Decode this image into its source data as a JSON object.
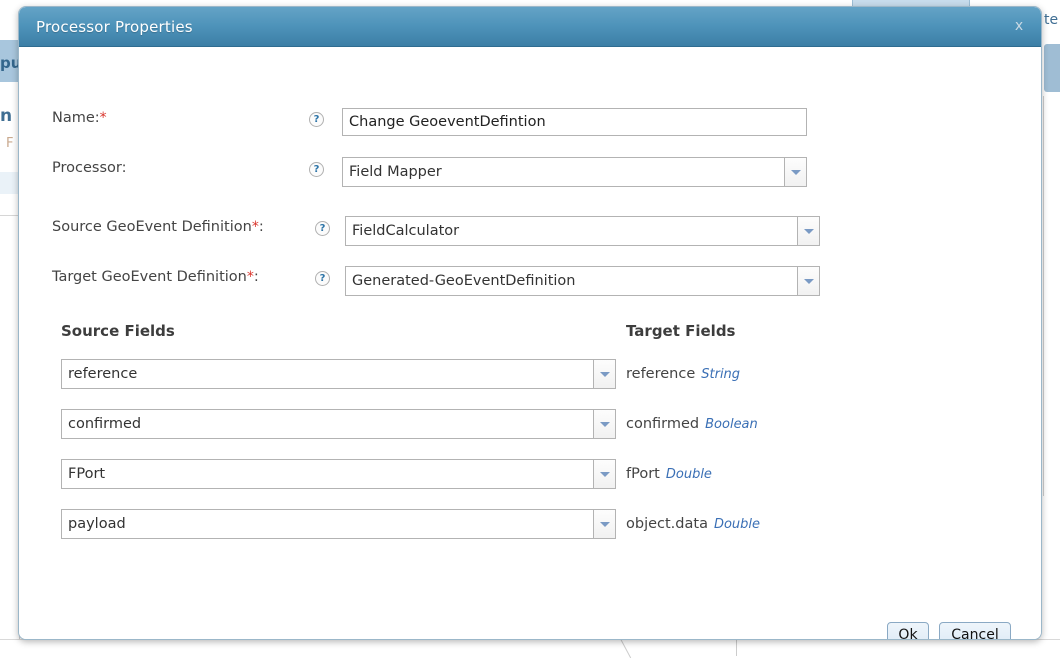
{
  "background": {
    "left_label_1": "pu",
    "left_label_2": "n",
    "left_label_3": "F",
    "right_label": "te"
  },
  "dialog": {
    "title": "Processor Properties",
    "close_label": "x",
    "help_icon": "question-mark-icon",
    "dropdown_icon": "chevron-down-icon",
    "properties": [
      {
        "label": "Name:",
        "required": true,
        "required_marker": "*",
        "control": "text",
        "value": "Change GeoeventDefintion"
      },
      {
        "label": "Processor:",
        "required": false,
        "required_marker": "",
        "control": "combo",
        "value": "Field Mapper"
      },
      {
        "label": "Source GeoEvent Definition",
        "required": true,
        "required_marker": "*",
        "label_suffix": ":",
        "control": "combo",
        "value": "FieldCalculator"
      },
      {
        "label": "Target GeoEvent Definition",
        "required": true,
        "required_marker": "*",
        "label_suffix": ":",
        "control": "combo",
        "value": "Generated-GeoEventDefinition"
      }
    ],
    "mapping": {
      "source_heading": "Source Fields",
      "target_heading": "Target Fields",
      "rows": [
        {
          "source": "reference",
          "target": "reference",
          "type": "String"
        },
        {
          "source": "confirmed",
          "target": "confirmed",
          "type": "Boolean"
        },
        {
          "source": "FPort",
          "target": "fPort",
          "type": "Double"
        },
        {
          "source": "payload",
          "target": "object.data",
          "type": "Double"
        }
      ]
    },
    "footer": {
      "ok_label": "Ok",
      "cancel_label": "Cancel"
    }
  },
  "colors": {
    "titlebar_top": "#64a3c6",
    "titlebar_bottom": "#3c7fa6",
    "required_star": "#d9342b",
    "type_text": "#3a6fb5",
    "help_mark": "#2e75a8",
    "dropdown_arrow": "#7a9ac4",
    "button_face": "#dce9f6"
  }
}
